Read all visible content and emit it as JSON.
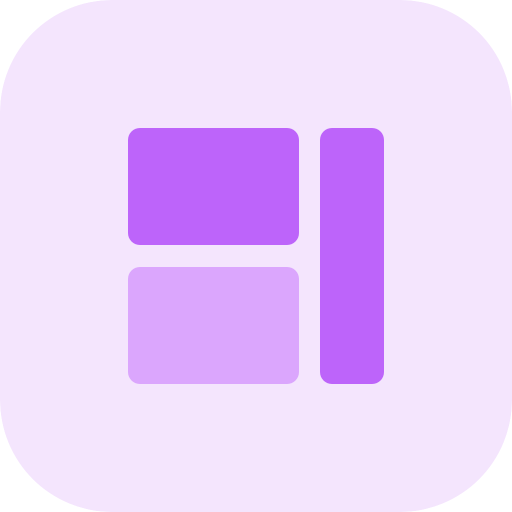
{
  "icon": {
    "name": "layout-dashboard-icon",
    "colors": {
      "background": "#F4E5FD",
      "primary": "#BD64FA",
      "secondary": "#DBA6FD"
    }
  }
}
